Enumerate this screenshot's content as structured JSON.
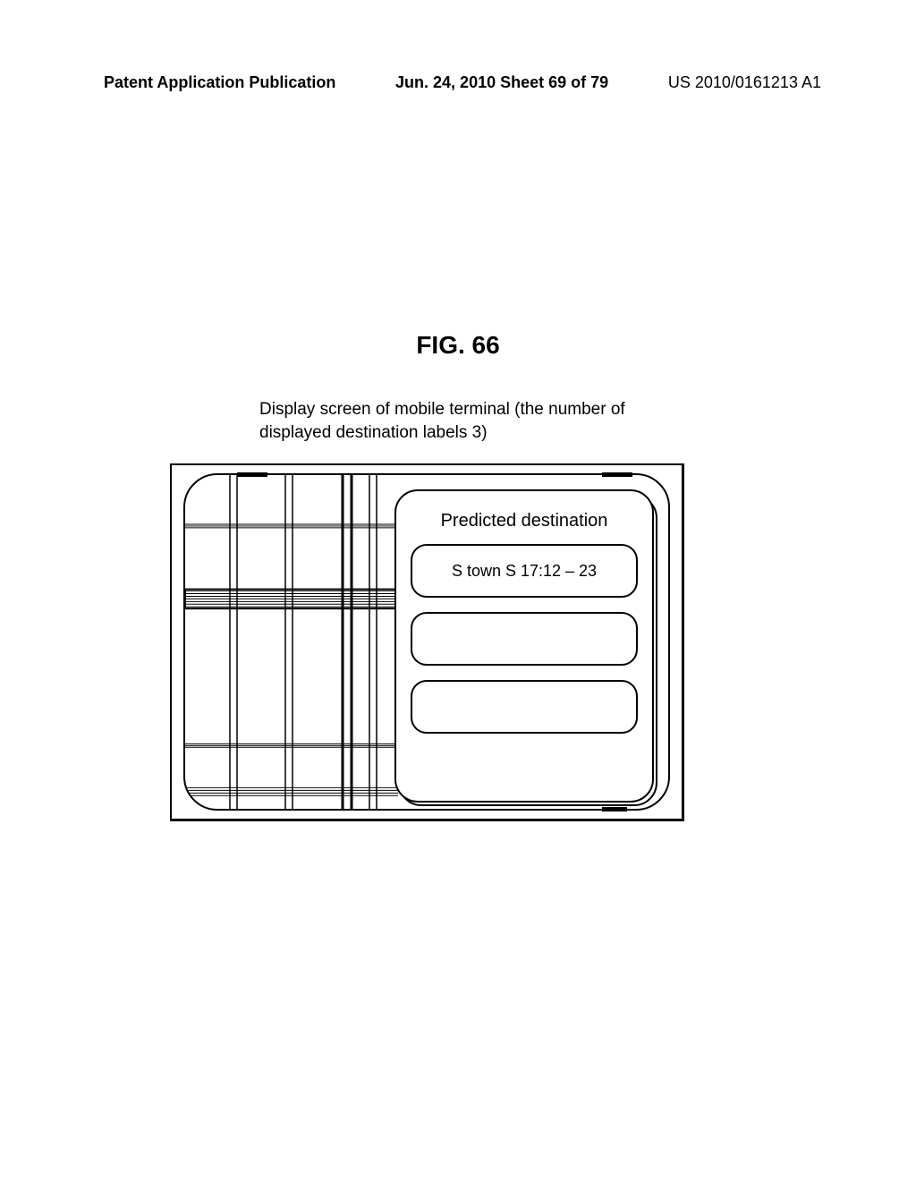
{
  "header": {
    "left": "Patent Application Publication",
    "center": "Jun. 24, 2010  Sheet 69 of 79",
    "right": "US 2010/0161213 A1"
  },
  "figure": {
    "title": "FIG. 66",
    "caption": "Display screen of mobile terminal (the number of displayed destination labels 3)"
  },
  "panel": {
    "title": "Predicted destination",
    "slots": [
      "S town S 17:12 – 23",
      "",
      ""
    ]
  }
}
